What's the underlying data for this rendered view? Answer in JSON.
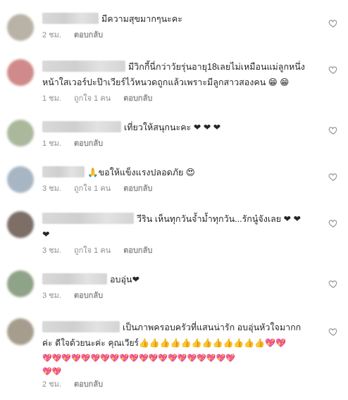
{
  "comments": [
    {
      "lines": [
        "มีความสุขมากๆนะคะ"
      ],
      "time": "2 ชม.",
      "likes": "",
      "reply": "ตอบกลับ",
      "avatar_color": "#b9b2a6"
    },
    {
      "lines": [
        "มีวิกกี้นี่กว่าวัยรุ่นอายุ18เลยไม่เหมือนแม่ลูกหนึ่ง",
        "หน้าใสเวอร์ปะป๊าเวียร์ไว้หนวดถูกแล้วเพราะมีลูกสาวสองคน 😁 😁"
      ],
      "time": "1 ชม.",
      "likes": "ถูกใจ 1 คน",
      "reply": "ตอบกลับ",
      "avatar_color": "#d08a8a"
    },
    {
      "lines": [
        "เที่ยวให้สนุกนะคะ ❤ ❤ ❤"
      ],
      "time": "1 ชม.",
      "likes": "",
      "reply": "ตอบกลับ",
      "avatar_color": "#aab89c"
    },
    {
      "lines": [
        "🙏ขอให้แข็งแรงปลอดภัย 😍"
      ],
      "time": "3 ชม.",
      "likes": "ถูกใจ 1 คน",
      "reply": "ตอบกลับ",
      "avatar_color": "#a8b6c4"
    },
    {
      "lines": [
        "วีริน เห็นทุกวันจ้ำม้ำทุกวัน...รักนู๋จังเลย ❤ ❤",
        "❤"
      ],
      "time": "3 ชม.",
      "likes": "ถูกใจ 1 คน",
      "reply": "ตอบกลับ",
      "avatar_color": "#7d6e66"
    },
    {
      "lines": [
        "อบอุ่น❤"
      ],
      "time": "3 ชม.",
      "likes": "",
      "reply": "ตอบกลับ",
      "avatar_color": "#8fa388"
    },
    {
      "lines": [
        "เป็นภาพครอบครัวที่แสนน่ารัก อบอุ่นหัวใจมากก",
        "ค่ะ ดีใจด้วยนะค่ะ คุณเวียร์👍👍👍👍👍👍👍👍👍👍👍👍💖💖",
        "💖💖💖💖💖💖💖💖💖💖💖💖💖💖💖💖💖💖💖💖",
        "💖💖"
      ],
      "time": "2 ชม.",
      "likes": "",
      "reply": "ตอบกลับ",
      "avatar_color": "#a79d8e"
    }
  ]
}
